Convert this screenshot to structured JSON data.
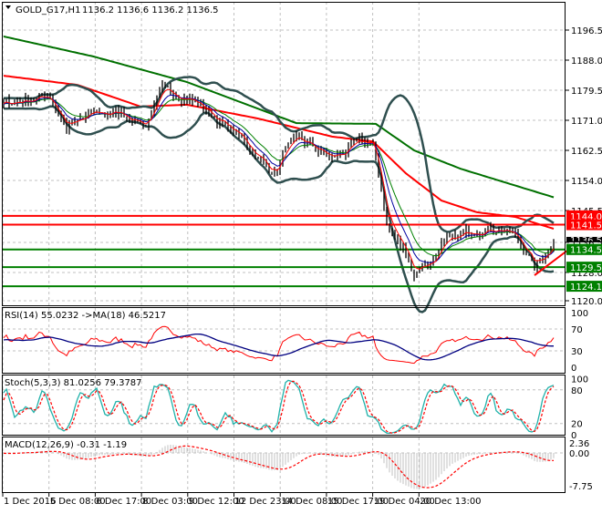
{
  "header": {
    "symbol_label": "GOLD_G17,H1",
    "ohlc": "1136.2 1136.6 1136.2 1136.5"
  },
  "chart_data": {
    "type": "line",
    "title": "GOLD_G17,H1",
    "price_axis": {
      "ticks": [
        "1196.5",
        "1188.0",
        "1179.5",
        "1171.0",
        "1162.5",
        "1154.0",
        "1145.5",
        "1136.5",
        "1128.0",
        "1120.0"
      ],
      "range": [
        1118.5,
        1204
      ]
    },
    "time_axis": {
      "ticks": [
        "1 Dec 2016",
        "5 Dec 08:00",
        "6 Dec 17:00",
        "8 Dec 03:00",
        "9 Dec 12:00",
        "12 Dec 23:00",
        "14 Dec 08:00",
        "15 Dec 17:00",
        "19 Dec 04:00",
        "20 Dec 13:00"
      ]
    },
    "bars": 202,
    "close_keypoints": [
      [
        0,
        1175.4
      ],
      [
        7,
        1176.7
      ],
      [
        17,
        1178
      ],
      [
        20,
        1173
      ],
      [
        23,
        1169
      ],
      [
        27,
        1170.2
      ],
      [
        33,
        1173
      ],
      [
        43,
        1173
      ],
      [
        52,
        1170
      ],
      [
        55,
        1175
      ],
      [
        58,
        1179
      ],
      [
        67,
        1178
      ],
      [
        72,
        1175
      ],
      [
        80,
        1170
      ],
      [
        88,
        1165
      ],
      [
        97,
        1157
      ],
      [
        100,
        1157
      ],
      [
        103,
        1163.8
      ],
      [
        108,
        1165
      ],
      [
        115,
        1162.5
      ],
      [
        120,
        1160
      ],
      [
        128,
        1163.8
      ],
      [
        135,
        1165
      ],
      [
        137,
        1154.8
      ],
      [
        140,
        1142
      ],
      [
        147,
        1133
      ],
      [
        150,
        1127.7
      ],
      [
        153,
        1130.3
      ],
      [
        157,
        1131.6
      ],
      [
        160,
        1135.5
      ],
      [
        167,
        1138
      ],
      [
        173,
        1140.6
      ],
      [
        182,
        1140.6
      ],
      [
        187,
        1138
      ],
      [
        192,
        1133
      ],
      [
        194,
        1129
      ],
      [
        198,
        1133.4
      ],
      [
        201,
        1136.5
      ]
    ],
    "ma_slow_keypoints": [
      [
        0,
        1194.7
      ],
      [
        33,
        1189
      ],
      [
        67,
        1181.8
      ],
      [
        107,
        1170.2
      ],
      [
        136,
        1170
      ],
      [
        150,
        1162.5
      ],
      [
        167,
        1157.3
      ],
      [
        202,
        1149
      ]
    ],
    "ma_mid_keypoints": [
      [
        0,
        1183.6
      ],
      [
        27,
        1181
      ],
      [
        50,
        1174.9
      ],
      [
        67,
        1175.4
      ],
      [
        93,
        1171.5
      ],
      [
        120,
        1166.4
      ],
      [
        135,
        1165
      ],
      [
        147,
        1156
      ],
      [
        160,
        1148.3
      ],
      [
        173,
        1145
      ],
      [
        187,
        1143.7
      ],
      [
        202,
        1140.1
      ]
    ],
    "levels": [
      {
        "price": 1144.0,
        "label": "1144.0",
        "color": "#ff0000"
      },
      {
        "price": 1141.5,
        "label": "1141.5",
        "color": "#ff0000"
      },
      {
        "price": 1134.5,
        "label": "1134.5",
        "color": "#008000"
      },
      {
        "price": 1129.5,
        "label": "1129.5",
        "color": "#008000"
      },
      {
        "price": 1124.1,
        "label": "1124.1",
        "color": "#008000"
      }
    ],
    "current_price": "1136.5",
    "trendline": [
      [
        194,
        1127.2
      ],
      [
        206,
        1134.2
      ]
    ],
    "rsi": {
      "label": "RSI(14) 55.0232  ->MA(18) 46.5217",
      "ticks": [
        "100",
        "70",
        "30",
        "0"
      ],
      "levels": [
        100,
        70,
        30,
        0
      ]
    },
    "stoch": {
      "label": "Stoch(5,3,3) 81.0256 79.3787",
      "ticks": [
        "100",
        "80",
        "20",
        "0"
      ],
      "levels": [
        100,
        80,
        20,
        0
      ]
    },
    "macd": {
      "label": "MACD(12,26,9) -0.31 -1.19",
      "ticks": [
        "2.36",
        "0.00",
        "-7.75"
      ],
      "levels": [
        2.36,
        0,
        -7.75
      ]
    }
  }
}
